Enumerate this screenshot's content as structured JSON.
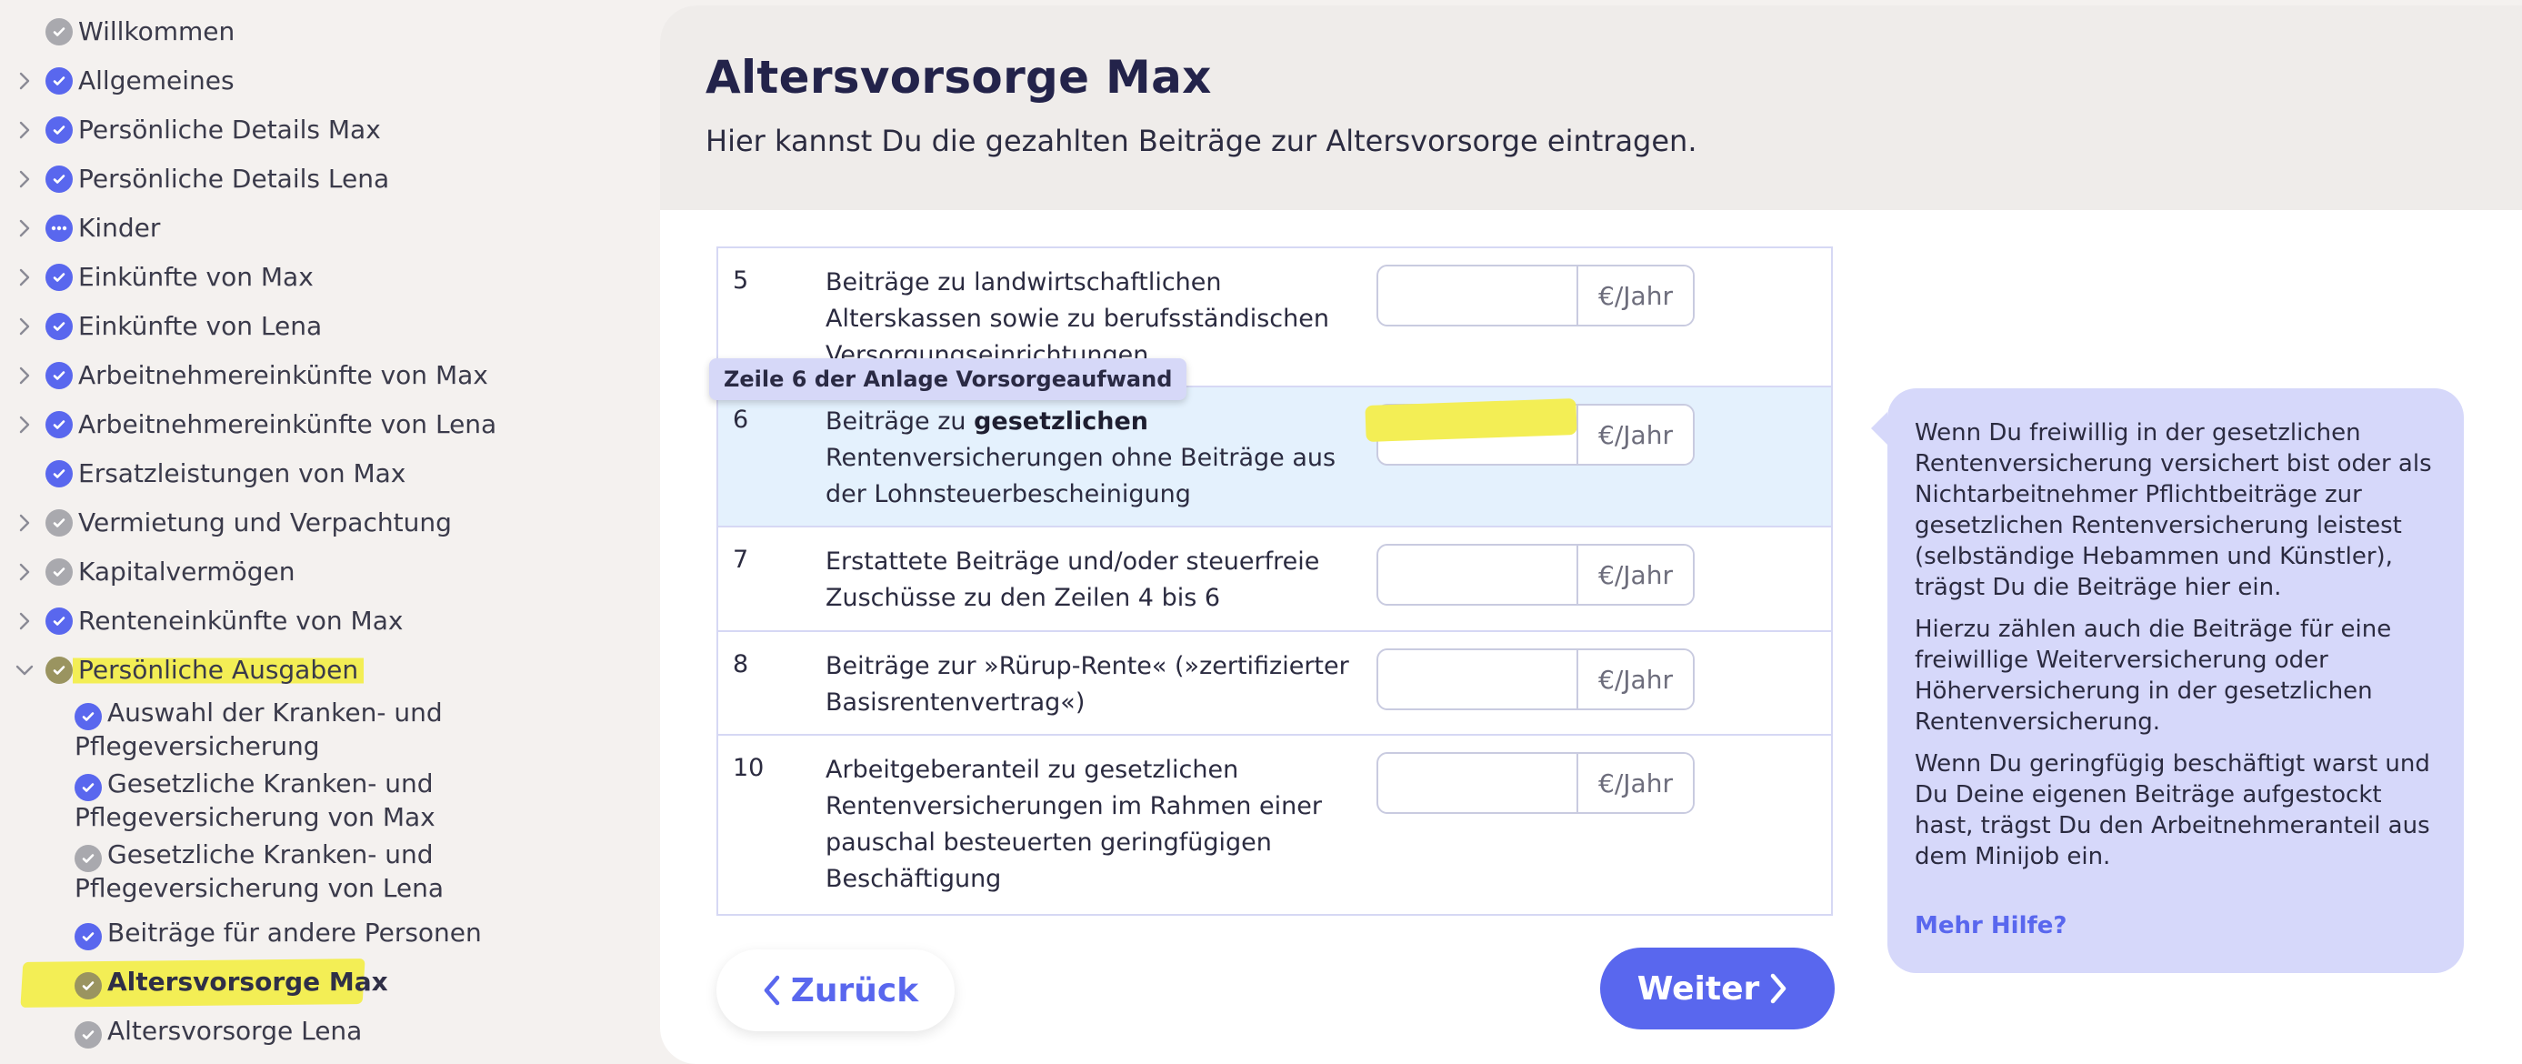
{
  "sidebar": {
    "items": [
      {
        "label": "Willkommen",
        "status": "grey",
        "chevron": "none"
      },
      {
        "label": "Allgemeines",
        "status": "done",
        "chevron": "right"
      },
      {
        "label": "Persönliche Details Max",
        "status": "done",
        "chevron": "right"
      },
      {
        "label": "Persönliche Details Lena",
        "status": "done",
        "chevron": "right"
      },
      {
        "label": "Kinder",
        "status": "partial",
        "chevron": "right"
      },
      {
        "label": "Einkünfte von Max",
        "status": "done",
        "chevron": "right"
      },
      {
        "label": "Einkünfte von Lena",
        "status": "done",
        "chevron": "right"
      },
      {
        "label": "Arbeitnehmereinkünfte von Max",
        "status": "done",
        "chevron": "right"
      },
      {
        "label": "Arbeitnehmereinkünfte von Lena",
        "status": "done",
        "chevron": "right"
      },
      {
        "label": "Ersatzleistungen von Max",
        "status": "done",
        "chevron": "none"
      },
      {
        "label": "Vermietung und Verpachtung",
        "status": "grey",
        "chevron": "right"
      },
      {
        "label": "Kapitalvermögen",
        "status": "grey",
        "chevron": "right"
      },
      {
        "label": "Renteneinkünfte von Max",
        "status": "done",
        "chevron": "right"
      },
      {
        "label": "Persönliche Ausgaben",
        "status": "active",
        "chevron": "down"
      }
    ],
    "subitems": [
      {
        "label": "Auswahl der Kranken- und Pflegeversicherung",
        "status": "done"
      },
      {
        "label": "Gesetzliche Kranken- und Pflegeversicherung von Max",
        "status": "done"
      },
      {
        "label": "Gesetzliche Kranken- und Pflegeversicherung von Lena",
        "status": "grey"
      },
      {
        "label": "Beiträge für andere Personen",
        "status": "done"
      },
      {
        "label": "Altersvorsorge Max",
        "status": "active"
      },
      {
        "label": "Altersvorsorge Lena",
        "status": "grey"
      }
    ]
  },
  "header": {
    "title": "Altersvorsorge Max",
    "subtitle": "Hier kannst Du die gezahlten Beiträge zur Altersvorsorge eintragen."
  },
  "form": {
    "unit": "€/Jahr",
    "rows": [
      {
        "num": "5",
        "text": "Beiträge zu landwirtschaftlichen Alterskassen sowie zu berufsständischen Versorgungseinrichtungen",
        "value": ""
      },
      {
        "num": "6",
        "text_pre": "Beiträge zu ",
        "text_bold": "gesetzlichen",
        "text_post": " Rentenversicherungen ohne Beiträge aus der Lohnsteuerbescheinigung",
        "value": ""
      },
      {
        "num": "7",
        "text": "Erstattete Beiträge und/oder steuerfreie Zuschüsse zu den Zeilen 4 bis 6",
        "value": ""
      },
      {
        "num": "8",
        "text": "Beiträge zur »Rürup-Rente« (»zertifizierter Basisrentenvertrag«)",
        "value": ""
      },
      {
        "num": "10",
        "text": "Arbeitgeberanteil zu gesetzlichen Rentenversicherungen im Rahmen einer pauschal besteuerten geringfügigen Beschäftigung",
        "value": ""
      }
    ],
    "tooltip": "Zeile 6 der Anlage Vorsorgeaufwand"
  },
  "help": {
    "paragraphs": [
      "Wenn Du freiwillig in der gesetzlichen Rentenversicherung versichert bist oder als Nichtarbeitnehmer Pflichtbeiträge zur gesetzlichen Rentenversicherung leistest (selbständige Hebammen und Künstler), trägst Du die Beiträge hier ein.",
      "Hierzu zählen auch die Beiträge für eine freiwillige Weiterversicherung oder Höherversicherung in der gesetzlichen Rentenversicherung.",
      "Wenn Du geringfügig beschäftigt warst und Du Deine eigenen Beiträge aufgestockt hast, trägst Du den Arbeitnehmeranteil aus dem Minijob ein."
    ],
    "more_label": "Mehr Hilfe?"
  },
  "buttons": {
    "back_label": "Zurück",
    "next_label": "Weiter"
  },
  "colors": {
    "accent": "#5967ee",
    "highlight": "#f3ee55",
    "help_bg": "#d6d8fa",
    "row_highlight": "#e4f1fd"
  }
}
